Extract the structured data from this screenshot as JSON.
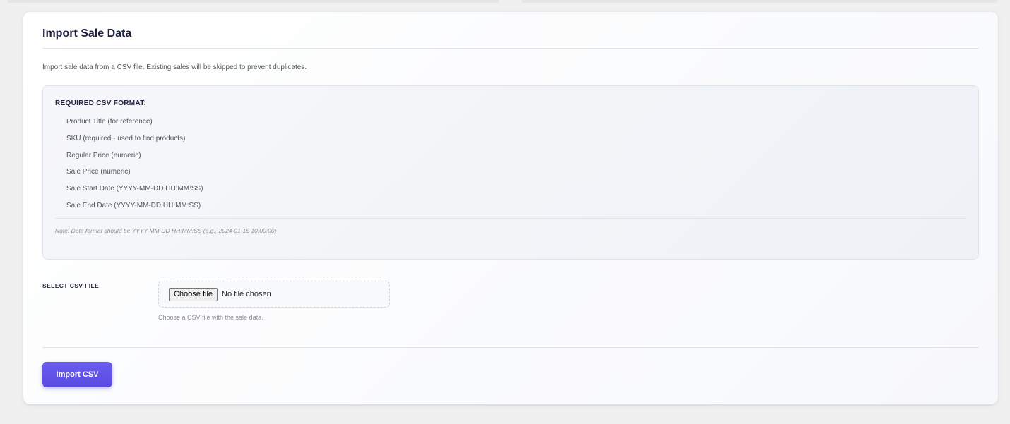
{
  "card": {
    "title": "Import Sale Data",
    "intro": "Import sale data from a CSV file. Existing sales will be skipped to prevent duplicates."
  },
  "format": {
    "heading": "REQUIRED CSV FORMAT:",
    "columns": [
      "Product Title (for reference)",
      "SKU (required - used to find products)",
      "Regular Price (numeric)",
      "Sale Price (numeric)",
      "Sale Start Date (YYYY-MM-DD HH:MM:SS)",
      "Sale End Date (YYYY-MM-DD HH:MM:SS)"
    ],
    "note": "Note: Date format should be YYYY-MM-DD HH:MM:SS (e.g., 2024-01-15 10:00:00)"
  },
  "file_field": {
    "label": "SELECT CSV FILE",
    "choose_label": "Choose file",
    "status": "No file chosen",
    "help": "Choose a CSV file with the sale data."
  },
  "actions": {
    "import_label": "Import CSV"
  },
  "colors": {
    "accent": "#5a4be0",
    "title": "#1e2240"
  }
}
